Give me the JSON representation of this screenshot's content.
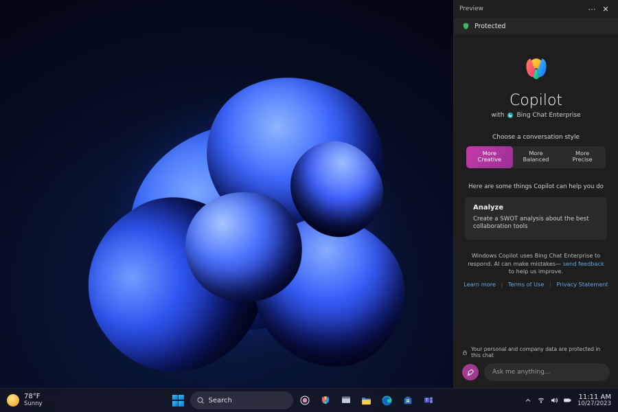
{
  "copilot": {
    "titlebar": {
      "label": "Preview"
    },
    "protected_label": "Protected",
    "app_name": "Copilot",
    "subline_prefix": "with",
    "subline_brand": "Bing Chat Enterprise",
    "choose_label": "Choose a conversation style",
    "styles": [
      {
        "line1": "More",
        "line2": "Creative",
        "active": true
      },
      {
        "line1": "More",
        "line2": "Balanced",
        "active": false
      },
      {
        "line1": "More",
        "line2": "Precise",
        "active": false
      }
    ],
    "helps_label": "Here are some things Copilot can help you do",
    "card": {
      "title": "Analyze",
      "body": "Create a SWOT analysis about the best collaboration tools"
    },
    "disclaimer_pre": "Windows Copilot uses Bing Chat Enterprise to respond. AI can make mistakes— ",
    "disclaimer_link": "send feedback",
    "disclaimer_post": " to help us improve.",
    "links": {
      "learn": "Learn more",
      "terms": "Terms of Use",
      "privacy": "Privacy Statement"
    },
    "footer_note": "Your personal and company data are protected in this chat",
    "input_placeholder": "Ask me anything..."
  },
  "taskbar": {
    "weather": {
      "temp": "78°F",
      "cond": "Sunny"
    },
    "search_label": "Search",
    "clock": {
      "time": "11:11 AM",
      "date": "10/27/2023"
    }
  }
}
